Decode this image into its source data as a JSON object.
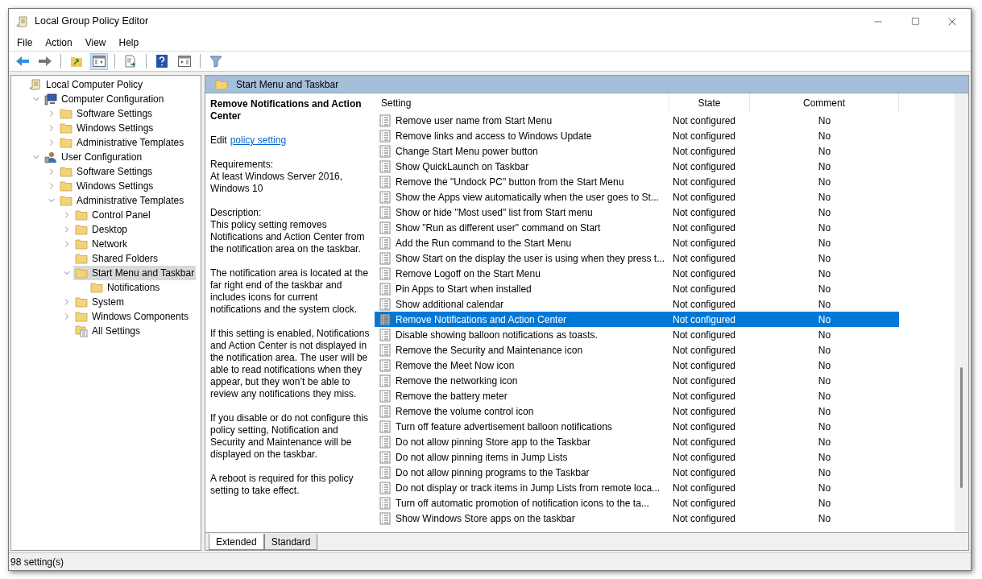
{
  "window": {
    "title": "Local Group Policy Editor"
  },
  "menu": [
    "File",
    "Action",
    "View",
    "Help"
  ],
  "toolbar": [
    [
      {
        "kind": "back",
        "pressed": false
      },
      {
        "kind": "forward",
        "pressed": false
      }
    ],
    [
      {
        "kind": "up",
        "pressed": false
      },
      {
        "kind": "tree",
        "pressed": true
      }
    ],
    [
      {
        "kind": "export",
        "pressed": false
      }
    ],
    [
      {
        "kind": "help",
        "pressed": false
      },
      {
        "kind": "panel",
        "pressed": false
      }
    ],
    [
      {
        "kind": "filter",
        "pressed": false
      }
    ]
  ],
  "tree": [
    {
      "label": "Local Computer Policy",
      "kind": "root",
      "selected": false,
      "children": [
        {
          "label": "Computer Configuration",
          "kind": "machine",
          "expanded": true,
          "selected": false,
          "children": [
            {
              "label": "Software Settings",
              "kind": "category",
              "expanded": false,
              "selected": false
            },
            {
              "label": "Windows Settings",
              "kind": "category",
              "expanded": false,
              "selected": false
            },
            {
              "label": "Administrative Templates",
              "kind": "category",
              "expanded": false,
              "selected": false
            }
          ]
        },
        {
          "label": "User Configuration",
          "kind": "account",
          "expanded": true,
          "selected": false,
          "children": [
            {
              "label": "Software Settings",
              "kind": "category",
              "expanded": false,
              "selected": false
            },
            {
              "label": "Windows Settings",
              "kind": "category",
              "expanded": false,
              "selected": false
            },
            {
              "label": "Administrative Templates",
              "kind": "category",
              "expanded": true,
              "selected": false,
              "children": [
                {
                  "label": "Control Panel",
                  "kind": "category",
                  "expanded": false,
                  "selected": false
                },
                {
                  "label": "Desktop",
                  "kind": "category",
                  "expanded": false,
                  "selected": false
                },
                {
                  "label": "Network",
                  "kind": "category",
                  "expanded": false,
                  "selected": false
                },
                {
                  "label": "Shared Folders",
                  "kind": "category",
                  "selected": false
                },
                {
                  "label": "Start Menu and Taskbar",
                  "kind": "category",
                  "expanded": true,
                  "selected": true,
                  "children": [
                    {
                      "label": "Notifications",
                      "kind": "category",
                      "selected": false
                    }
                  ]
                },
                {
                  "label": "System",
                  "kind": "category",
                  "expanded": false,
                  "selected": false
                },
                {
                  "label": "Windows Components",
                  "kind": "category",
                  "expanded": false,
                  "selected": false
                },
                {
                  "label": "All Settings",
                  "kind": "aggregate",
                  "selected": false
                }
              ]
            }
          ]
        }
      ]
    }
  ],
  "pane_header": "Start Menu and Taskbar",
  "details": {
    "title": "Remove Notifications and Action Center",
    "edit_prefix": "Edit",
    "edit_link": "policy setting",
    "paragraphs": [
      "Requirements:\nAt least Windows Server 2016, Windows 10",
      "Description:\nThis policy setting removes Notifications and Action Center from the notification area on the taskbar.",
      "The notification area is located at the far right end of the taskbar and includes icons for current notifications and the system clock.",
      "If this setting is enabled, Notifications and Action Center is not displayed in the notification area. The user will be able to read notifications when they appear, but they won’t be able to review any notifications they miss.",
      "If you disable or do not configure this policy setting, Notification and Security and Maintenance will be displayed on the taskbar.",
      "A reboot is required for this policy setting to take effect."
    ]
  },
  "table": {
    "columns": [
      "Setting",
      "State",
      "Comment"
    ],
    "rows": [
      {
        "setting": "Remove user name from Start Menu",
        "state": "Not configured",
        "comment": "No",
        "selected": false
      },
      {
        "setting": "Remove links and access to Windows Update",
        "state": "Not configured",
        "comment": "No",
        "selected": false
      },
      {
        "setting": "Change Start Menu power button",
        "state": "Not configured",
        "comment": "No",
        "selected": false
      },
      {
        "setting": "Show QuickLaunch on Taskbar",
        "state": "Not configured",
        "comment": "No",
        "selected": false
      },
      {
        "setting": "Remove the \"Undock PC\" button from the Start Menu",
        "state": "Not configured",
        "comment": "No",
        "selected": false
      },
      {
        "setting": "Show the Apps view automatically when the user goes to St...",
        "state": "Not configured",
        "comment": "No",
        "selected": false
      },
      {
        "setting": "Show or hide \"Most used\" list from Start menu",
        "state": "Not configured",
        "comment": "No",
        "selected": false
      },
      {
        "setting": "Show \"Run as different user\" command on Start",
        "state": "Not configured",
        "comment": "No",
        "selected": false
      },
      {
        "setting": "Add the Run command to the Start Menu",
        "state": "Not configured",
        "comment": "No",
        "selected": false
      },
      {
        "setting": "Show Start on the display the user is using when they press t...",
        "state": "Not configured",
        "comment": "No",
        "selected": false
      },
      {
        "setting": "Remove Logoff on the Start Menu",
        "state": "Not configured",
        "comment": "No",
        "selected": false
      },
      {
        "setting": "Pin Apps to Start when installed",
        "state": "Not configured",
        "comment": "No",
        "selected": false
      },
      {
        "setting": "Show additional calendar",
        "state": "Not configured",
        "comment": "No",
        "selected": false
      },
      {
        "setting": "Remove Notifications and Action Center",
        "state": "Not configured",
        "comment": "No",
        "selected": true
      },
      {
        "setting": "Disable showing balloon notifications as toasts.",
        "state": "Not configured",
        "comment": "No",
        "selected": false
      },
      {
        "setting": "Remove the Security and Maintenance icon",
        "state": "Not configured",
        "comment": "No",
        "selected": false
      },
      {
        "setting": "Remove the Meet Now icon",
        "state": "Not configured",
        "comment": "No",
        "selected": false
      },
      {
        "setting": "Remove the networking icon",
        "state": "Not configured",
        "comment": "No",
        "selected": false
      },
      {
        "setting": "Remove the battery meter",
        "state": "Not configured",
        "comment": "No",
        "selected": false
      },
      {
        "setting": "Remove the volume control icon",
        "state": "Not configured",
        "comment": "No",
        "selected": false
      },
      {
        "setting": "Turn off feature advertisement balloon notifications",
        "state": "Not configured",
        "comment": "No",
        "selected": false
      },
      {
        "setting": "Do not allow pinning Store app to the Taskbar",
        "state": "Not configured",
        "comment": "No",
        "selected": false
      },
      {
        "setting": "Do not allow pinning items in Jump Lists",
        "state": "Not configured",
        "comment": "No",
        "selected": false
      },
      {
        "setting": "Do not allow pinning programs to the Taskbar",
        "state": "Not configured",
        "comment": "No",
        "selected": false
      },
      {
        "setting": "Do not display or track items in Jump Lists from remote loca...",
        "state": "Not configured",
        "comment": "No",
        "selected": false
      },
      {
        "setting": "Turn off automatic promotion of notification icons to the ta...",
        "state": "Not configured",
        "comment": "No",
        "selected": false
      },
      {
        "setting": "Show Windows Store apps on the taskbar",
        "state": "Not configured",
        "comment": "No",
        "selected": false
      }
    ]
  },
  "view_tabs": [
    {
      "label": "Extended",
      "selected": true
    },
    {
      "label": "Standard",
      "selected": false
    }
  ],
  "status_bar": "98 setting(s)"
}
